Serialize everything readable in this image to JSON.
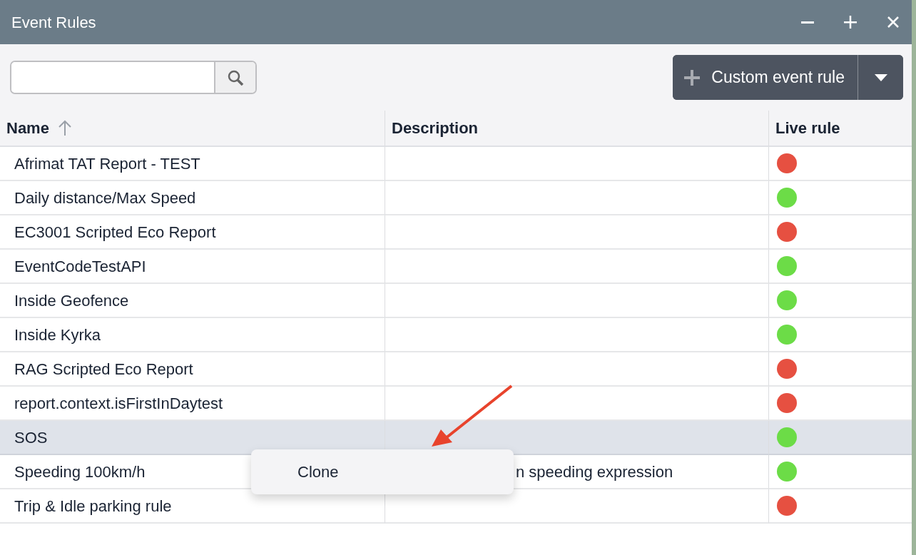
{
  "window": {
    "title": "Event Rules"
  },
  "toolbar": {
    "add_button": "Custom event rule"
  },
  "table": {
    "columns": [
      {
        "label": "Name",
        "sorted": true
      },
      {
        "label": "Description"
      },
      {
        "label": "Live rule"
      }
    ],
    "rows": [
      {
        "name": "Afrimat TAT Report - TEST",
        "live": false,
        "selected": false
      },
      {
        "name": "Daily distance/Max Speed",
        "live": true,
        "selected": false
      },
      {
        "name": "EC3001 Scripted Eco Report",
        "live": false,
        "selected": false
      },
      {
        "name": "EventCodeTestAPI",
        "live": true,
        "selected": false
      },
      {
        "name": "Inside Geofence",
        "live": true,
        "selected": false
      },
      {
        "name": "Inside Kyrka",
        "live": true,
        "selected": false
      },
      {
        "name": "RAG Scripted Eco Report",
        "live": false,
        "selected": false
      },
      {
        "name": "report.context.isFirstInDaytest",
        "live": false,
        "selected": false
      },
      {
        "name": "SOS",
        "live": true,
        "selected": true
      },
      {
        "name": "Speeding 100km/h",
        "description": "n speeding expression",
        "live": true,
        "selected": false
      },
      {
        "name": "Trip & Idle parking rule",
        "live": false,
        "selected": false
      }
    ]
  },
  "context_menu": {
    "items": [
      "Clone"
    ]
  }
}
